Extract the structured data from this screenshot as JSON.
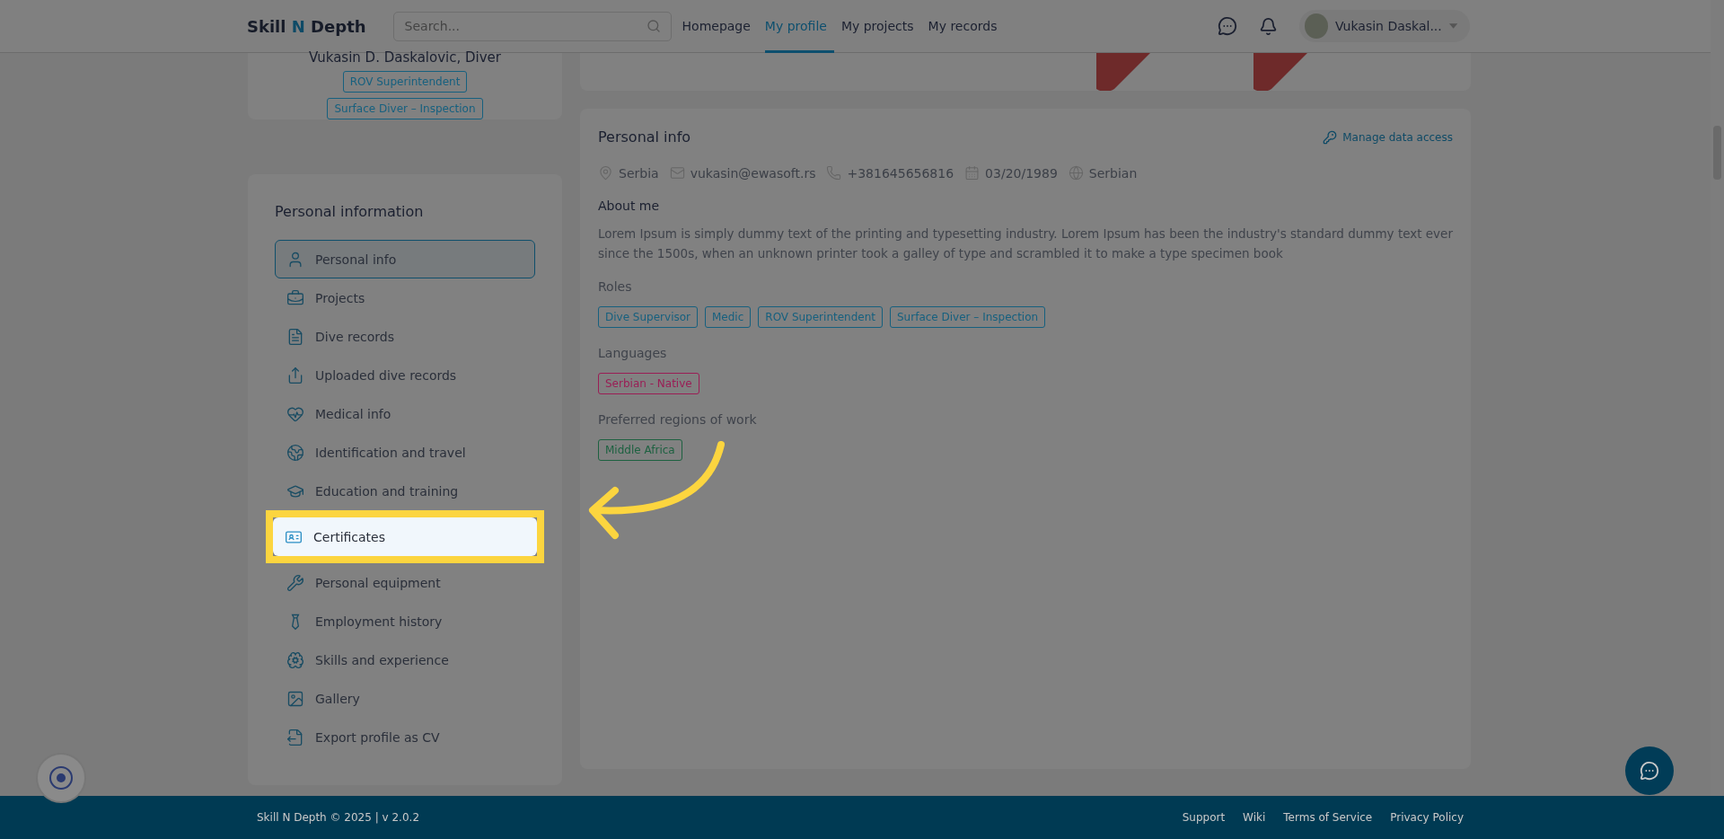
{
  "header": {
    "logo": {
      "first": "Skill",
      "accent": "N",
      "last": "Depth"
    },
    "search": {
      "placeholder": "Search..."
    },
    "nav": [
      {
        "label": "Homepage",
        "selected": false
      },
      {
        "label": "My profile",
        "selected": true
      },
      {
        "label": "My projects",
        "selected": false
      },
      {
        "label": "My records",
        "selected": false
      }
    ],
    "user": {
      "name": "Vukasin Daskal..."
    }
  },
  "profile_card": {
    "name": "Vukasin D. Daskalovic, Diver",
    "roles": [
      "ROV Superintendent",
      "Surface Diver – Inspection"
    ]
  },
  "sidebar": {
    "title": "Personal information",
    "items": [
      {
        "label": "Personal info",
        "selected": true,
        "highlighted": false
      },
      {
        "label": "Projects",
        "selected": false,
        "highlighted": false
      },
      {
        "label": "Dive records",
        "selected": false,
        "highlighted": false
      },
      {
        "label": "Uploaded dive records",
        "selected": false,
        "highlighted": false
      },
      {
        "label": "Medical info",
        "selected": false,
        "highlighted": false
      },
      {
        "label": "Identification and travel",
        "selected": false,
        "highlighted": false
      },
      {
        "label": "Education and training",
        "selected": false,
        "highlighted": false
      },
      {
        "label": "Certificates",
        "selected": false,
        "highlighted": true
      },
      {
        "label": "Personal equipment",
        "selected": false,
        "highlighted": false
      },
      {
        "label": "Employment history",
        "selected": false,
        "highlighted": false
      },
      {
        "label": "Skills and experience",
        "selected": false,
        "highlighted": false
      },
      {
        "label": "Gallery",
        "selected": false,
        "highlighted": false
      },
      {
        "label": "Export profile as CV",
        "selected": false,
        "highlighted": false
      }
    ]
  },
  "personal_info": {
    "title": "Personal info",
    "manage_link": "Manage data access",
    "contacts": [
      "Serbia",
      "vukasin@ewasoft.rs",
      "+381645656816",
      "03/20/1989",
      "Serbian"
    ],
    "about_title": "About me",
    "about_text": "Lorem Ipsum is simply dummy text of the printing and typesetting industry. Lorem Ipsum has been the industry's standard dummy text ever since the 1500s, when an unknown printer took a galley of type and scrambled it to make a type specimen book",
    "sections": [
      {
        "title": "Roles",
        "color": "#16607f",
        "tags": [
          "Dive Supervisor",
          "Medic",
          "ROV Superintendent",
          "Surface Diver – Inspection"
        ]
      },
      {
        "title": "Languages",
        "color": "#9a1d55",
        "tags": [
          "Serbian - Native"
        ]
      },
      {
        "title": "Preferred regions of work",
        "color": "#1d6140",
        "tags": [
          "Middle Africa"
        ]
      }
    ]
  },
  "footer": {
    "copyright": "Skill N Depth © 2025 | v 2.0.2",
    "links": [
      "Support",
      "Wiki",
      "Terms of Service",
      "Privacy Policy"
    ]
  }
}
